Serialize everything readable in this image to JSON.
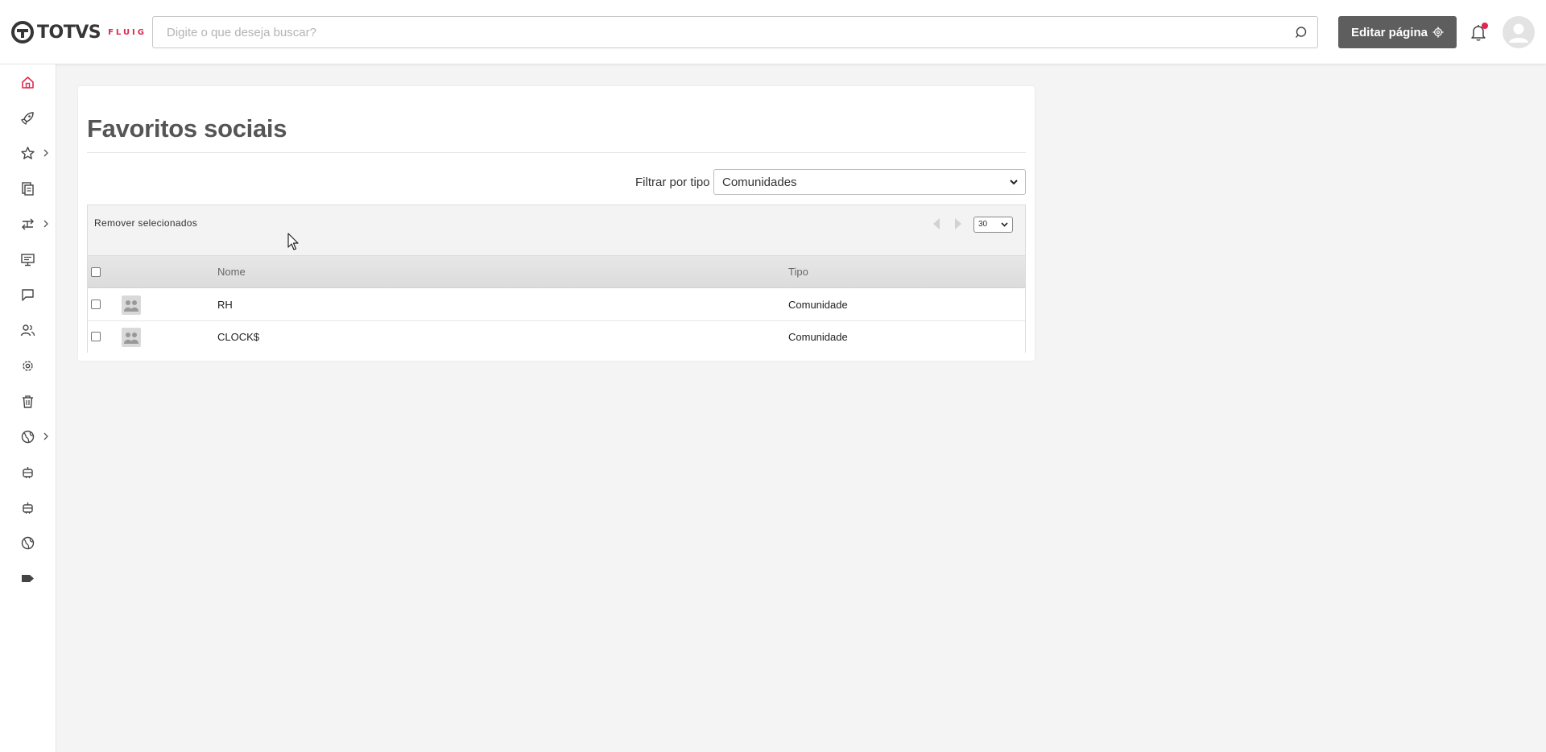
{
  "header": {
    "logo_text": "TOTVS",
    "logo_sub": "FLUIG",
    "search_placeholder": "Digite o que deseja buscar?",
    "edit_button_label": "Editar página"
  },
  "sidebar": {
    "items": [
      {
        "icon": "home-icon",
        "active": true,
        "has_submenu": false
      },
      {
        "icon": "rocket-icon",
        "active": false,
        "has_submenu": false
      },
      {
        "icon": "star-icon",
        "active": false,
        "has_submenu": true
      },
      {
        "icon": "documents-icon",
        "active": false,
        "has_submenu": false
      },
      {
        "icon": "workflow-icon",
        "active": false,
        "has_submenu": true
      },
      {
        "icon": "presentation-icon",
        "active": false,
        "has_submenu": false
      },
      {
        "icon": "chat-icon",
        "active": false,
        "has_submenu": false
      },
      {
        "icon": "users-icon",
        "active": false,
        "has_submenu": false
      },
      {
        "icon": "gear-icon",
        "active": false,
        "has_submenu": false
      },
      {
        "icon": "trash-icon",
        "active": false,
        "has_submenu": false
      },
      {
        "icon": "globe-icon",
        "active": false,
        "has_submenu": true
      },
      {
        "icon": "robot-icon",
        "active": false,
        "has_submenu": false
      },
      {
        "icon": "robot-icon",
        "active": false,
        "has_submenu": false
      },
      {
        "icon": "globe-icon",
        "active": false,
        "has_submenu": false
      },
      {
        "icon": "tag-icon",
        "active": false,
        "has_submenu": false
      }
    ]
  },
  "main": {
    "title": "Favoritos sociais",
    "filter_label": "Filtrar por tipo",
    "filter_value": "Comunidades",
    "toolbar": {
      "remove_label": "Remover selecionados",
      "page_size": "30"
    },
    "columns": {
      "name": "Nome",
      "type": "Tipo"
    },
    "rows": [
      {
        "name": "RH",
        "type": "Comunidade"
      },
      {
        "name": "CLOCK$",
        "type": "Comunidade"
      }
    ]
  },
  "colors": {
    "brand_red": "#e0284f",
    "button_gray": "#5e5e5e",
    "page_background": "#f4f4f4"
  }
}
